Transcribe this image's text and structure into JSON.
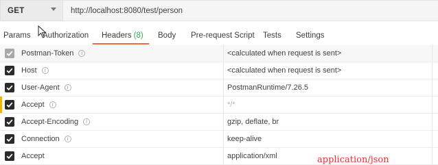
{
  "request": {
    "method": "GET",
    "url": "http://localhost:8080/test/person"
  },
  "tabs": {
    "params": "Params",
    "authorization": "Authorization",
    "headers": "Headers",
    "headers_count": "(8)",
    "body": "Body",
    "prerequest": "Pre-request Script",
    "tests": "Tests",
    "settings": "Settings"
  },
  "headers": [
    {
      "key": "Postman-Token",
      "value": "<calculated when request is sent>",
      "checked": true,
      "disabled": true,
      "info": true
    },
    {
      "key": "Host",
      "value": "<calculated when request is sent>",
      "checked": true,
      "disabled": false,
      "info": true
    },
    {
      "key": "User-Agent",
      "value": "PostmanRuntime/7.26.5",
      "checked": true,
      "disabled": false,
      "info": true
    },
    {
      "key": "Accept",
      "value": "*/*",
      "checked": true,
      "disabled": false,
      "info": true
    },
    {
      "key": "Accept-Encoding",
      "value": "gzip, deflate, br",
      "checked": true,
      "disabled": false,
      "info": true
    },
    {
      "key": "Connection",
      "value": "keep-alive",
      "checked": true,
      "disabled": false,
      "info": true
    },
    {
      "key": "Accept",
      "value": "application/xml",
      "checked": true,
      "disabled": false,
      "info": false
    }
  ],
  "annotation": "application/json",
  "colors": {
    "active_tab_underline": "#f26b3a",
    "headers_count": "#34a853",
    "annotation": "#e0332f",
    "focus_bar": "#f4b400"
  }
}
